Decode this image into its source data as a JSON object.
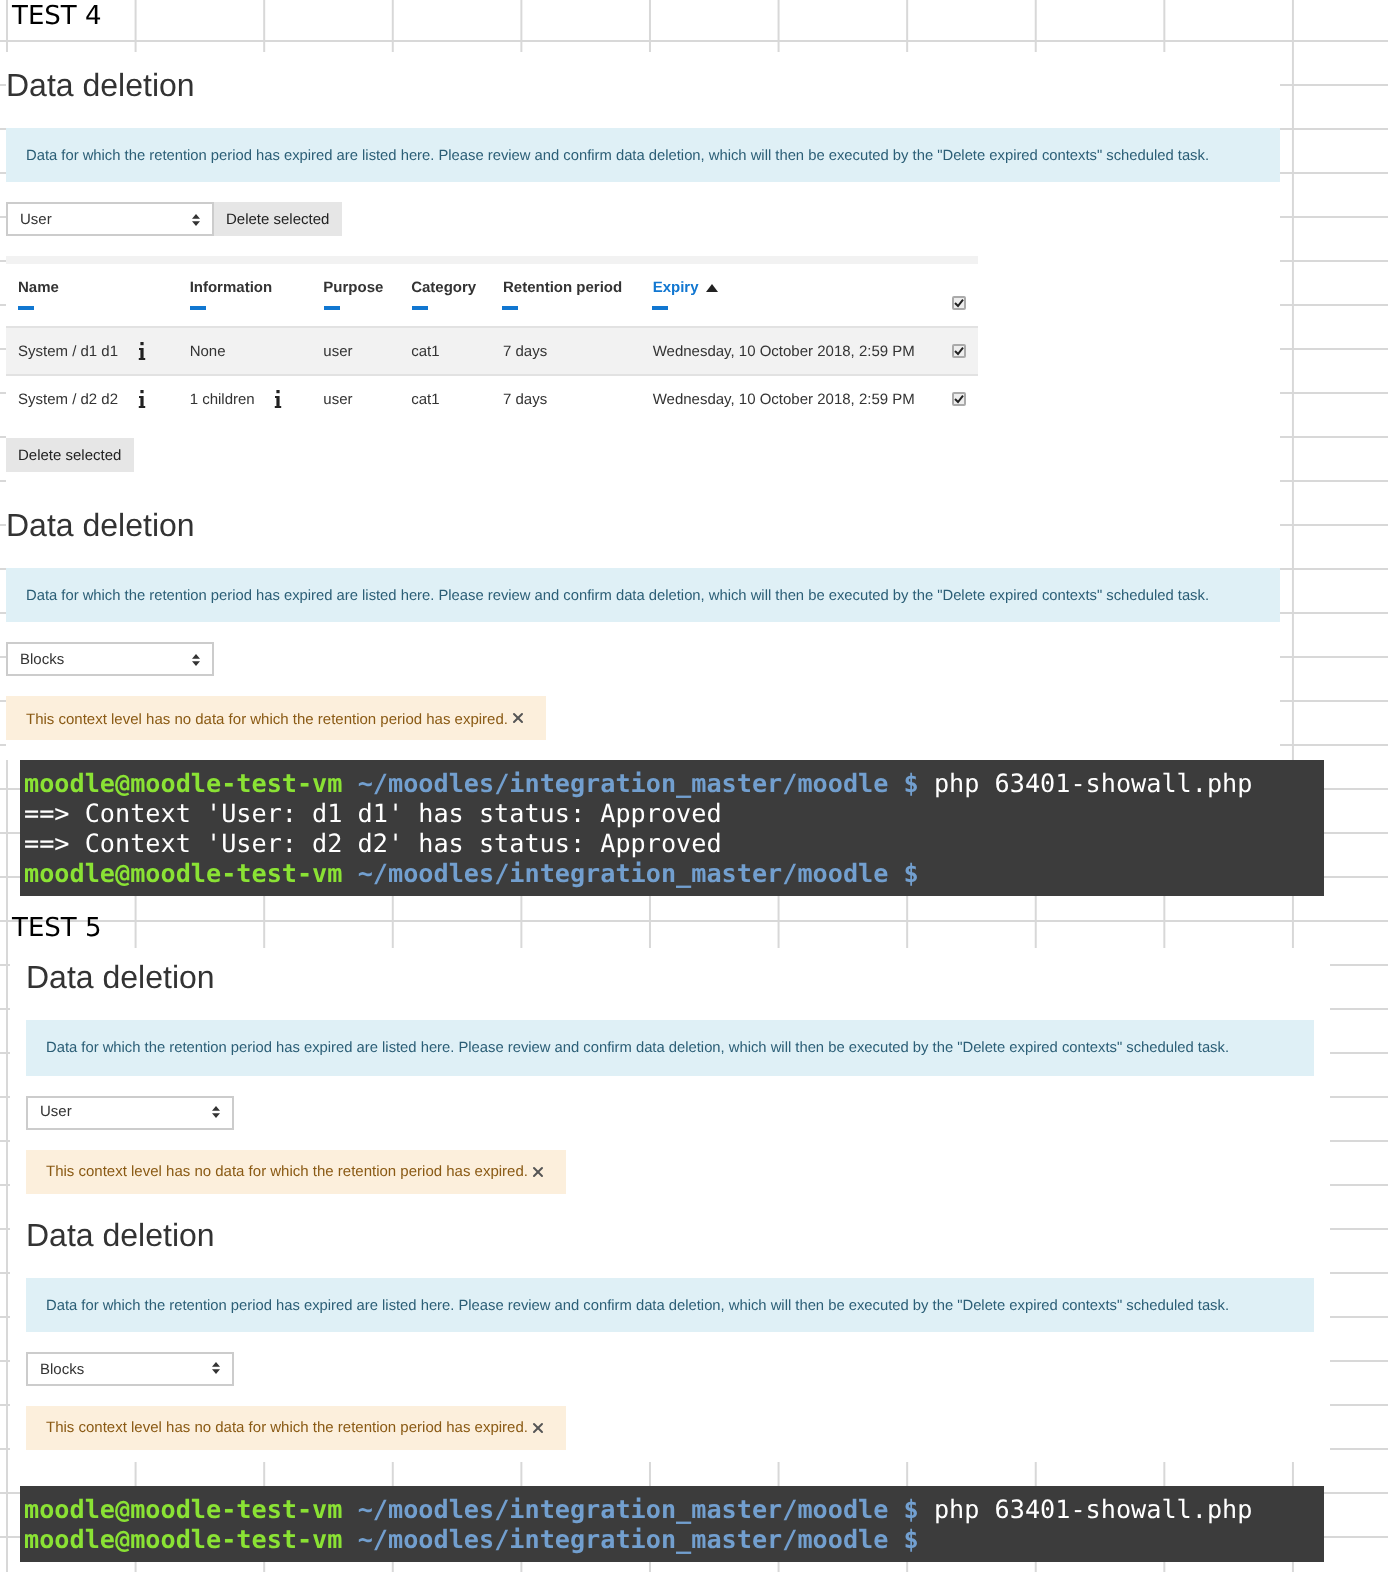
{
  "sections": [
    {
      "label": "TEST 4",
      "panels": [
        {
          "kind": "table",
          "heading": "Data deletion",
          "info": "Data for which the retention period has expired are listed here. Please review and confirm data deletion, which will then be executed by the \"Delete expired contexts\" scheduled task.",
          "select": "User",
          "button": "Delete selected",
          "table": {
            "all_checked": true,
            "columns": [
              {
                "label": "Name",
                "sorted": false
              },
              {
                "label": "Information",
                "sorted": false
              },
              {
                "label": "Purpose",
                "sorted": false
              },
              {
                "label": "Category",
                "sorted": false
              },
              {
                "label": "Retention period",
                "sorted": false
              },
              {
                "label": "Expiry",
                "sorted": true
              }
            ],
            "rows": [
              {
                "checked": true,
                "cells": [
                  {
                    "text": "System / d1 d1",
                    "info": true
                  },
                  {
                    "text": "None",
                    "info": false
                  },
                  {
                    "text": "user",
                    "info": false
                  },
                  {
                    "text": "cat1",
                    "info": false
                  },
                  {
                    "text": "7 days",
                    "info": false
                  },
                  {
                    "text": "Wednesday, 10 October 2018, 2:59 PM",
                    "info": false
                  }
                ]
              },
              {
                "checked": true,
                "cells": [
                  {
                    "text": "System / d2 d2",
                    "info": true
                  },
                  {
                    "text": "1 children",
                    "info": true
                  },
                  {
                    "text": "user",
                    "info": false
                  },
                  {
                    "text": "cat1",
                    "info": false
                  },
                  {
                    "text": "7 days",
                    "info": false
                  },
                  {
                    "text": "Wednesday, 10 October 2018, 2:59 PM",
                    "info": false
                  }
                ]
              }
            ]
          },
          "footer_button": "Delete selected"
        },
        {
          "kind": "notice",
          "heading": "Data deletion",
          "info": "Data for which the retention period has expired are listed here. Please review and confirm data deletion, which will then be executed by the \"Delete expired contexts\" scheduled task.",
          "select": "Blocks",
          "notice": "This context level has no data for which the retention period has expired."
        }
      ],
      "terminal": [
        {
          "kind": "prompt",
          "user": "moodle@moodle-test-vm",
          "path": "~/moodles/integration_master/moodle $",
          "command": "php 63401-showall.php"
        },
        {
          "kind": "output",
          "text": "==> Context 'User: d1 d1' has status: Approved"
        },
        {
          "kind": "output",
          "text": "==> Context 'User: d2 d2' has status: Approved"
        },
        {
          "kind": "prompt",
          "user": "moodle@moodle-test-vm",
          "path": "~/moodles/integration_master/moodle $"
        }
      ]
    },
    {
      "label": "TEST 5",
      "panels": [
        {
          "kind": "notice",
          "heading": "Data deletion",
          "info": "Data for which the retention period has expired are listed here. Please review and confirm data deletion, which will then be executed by the \"Delete expired contexts\" scheduled task.",
          "select": "User",
          "notice": "This context level has no data for which the retention period has expired."
        },
        {
          "kind": "notice",
          "heading": "Data deletion",
          "info": "Data for which the retention period has expired are listed here. Please review and confirm data deletion, which will then be executed by the \"Delete expired contexts\" scheduled task.",
          "select": "Blocks",
          "notice": "This context level has no data for which the retention period has expired."
        }
      ],
      "terminal": [
        {
          "kind": "prompt",
          "user": "moodle@moodle-test-vm",
          "path": "~/moodles/integration_master/moodle $",
          "command": "php 63401-showall.php"
        },
        {
          "kind": "prompt",
          "user": "moodle@moodle-test-vm",
          "path": "~/moodles/integration_master/moodle $"
        }
      ]
    }
  ]
}
